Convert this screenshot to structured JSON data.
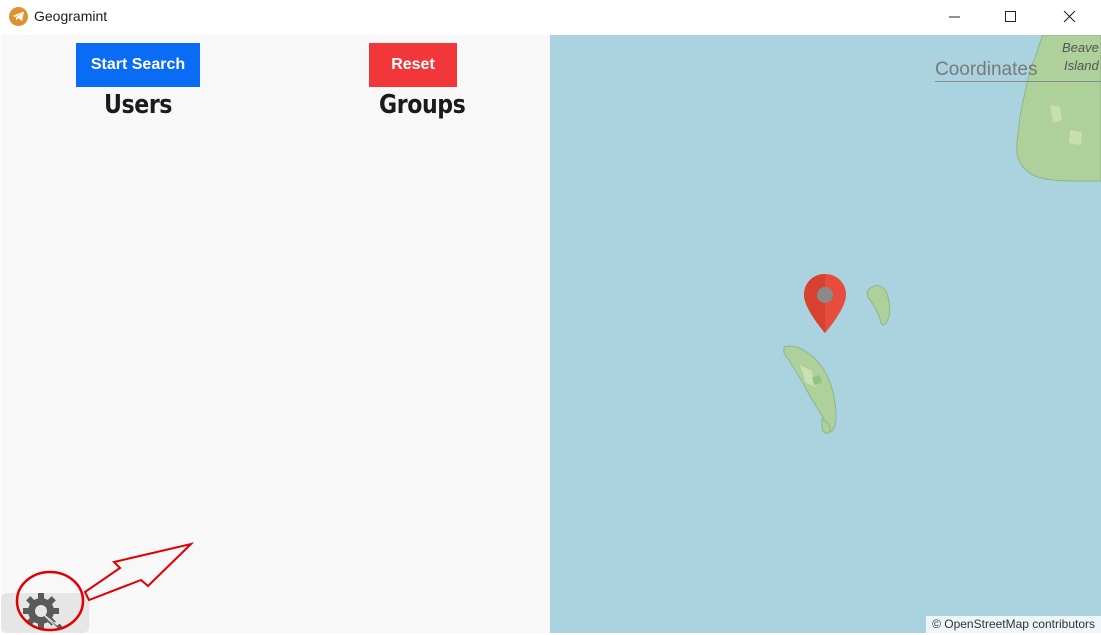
{
  "window": {
    "title": "Geogramint"
  },
  "toolbar": {
    "start_label": "Start Search",
    "reset_label": "Reset"
  },
  "panels": {
    "users_heading": "Users",
    "groups_heading": "Groups"
  },
  "map": {
    "coordinates_placeholder": "Coordinates",
    "island_label_line1": "Beave",
    "island_label_line2": "Island",
    "attribution": "© OpenStreetMap contributors"
  },
  "colors": {
    "start_button": "#0a6cf5",
    "reset_button": "#f1373a",
    "water": "#aad3df",
    "land": "#aed09a",
    "marker": "#e74c3c",
    "annotation": "#e00000"
  },
  "icons": {
    "app": "telegram-icon",
    "settings": "gear-wrench-icon",
    "marker": "map-pin-icon"
  }
}
